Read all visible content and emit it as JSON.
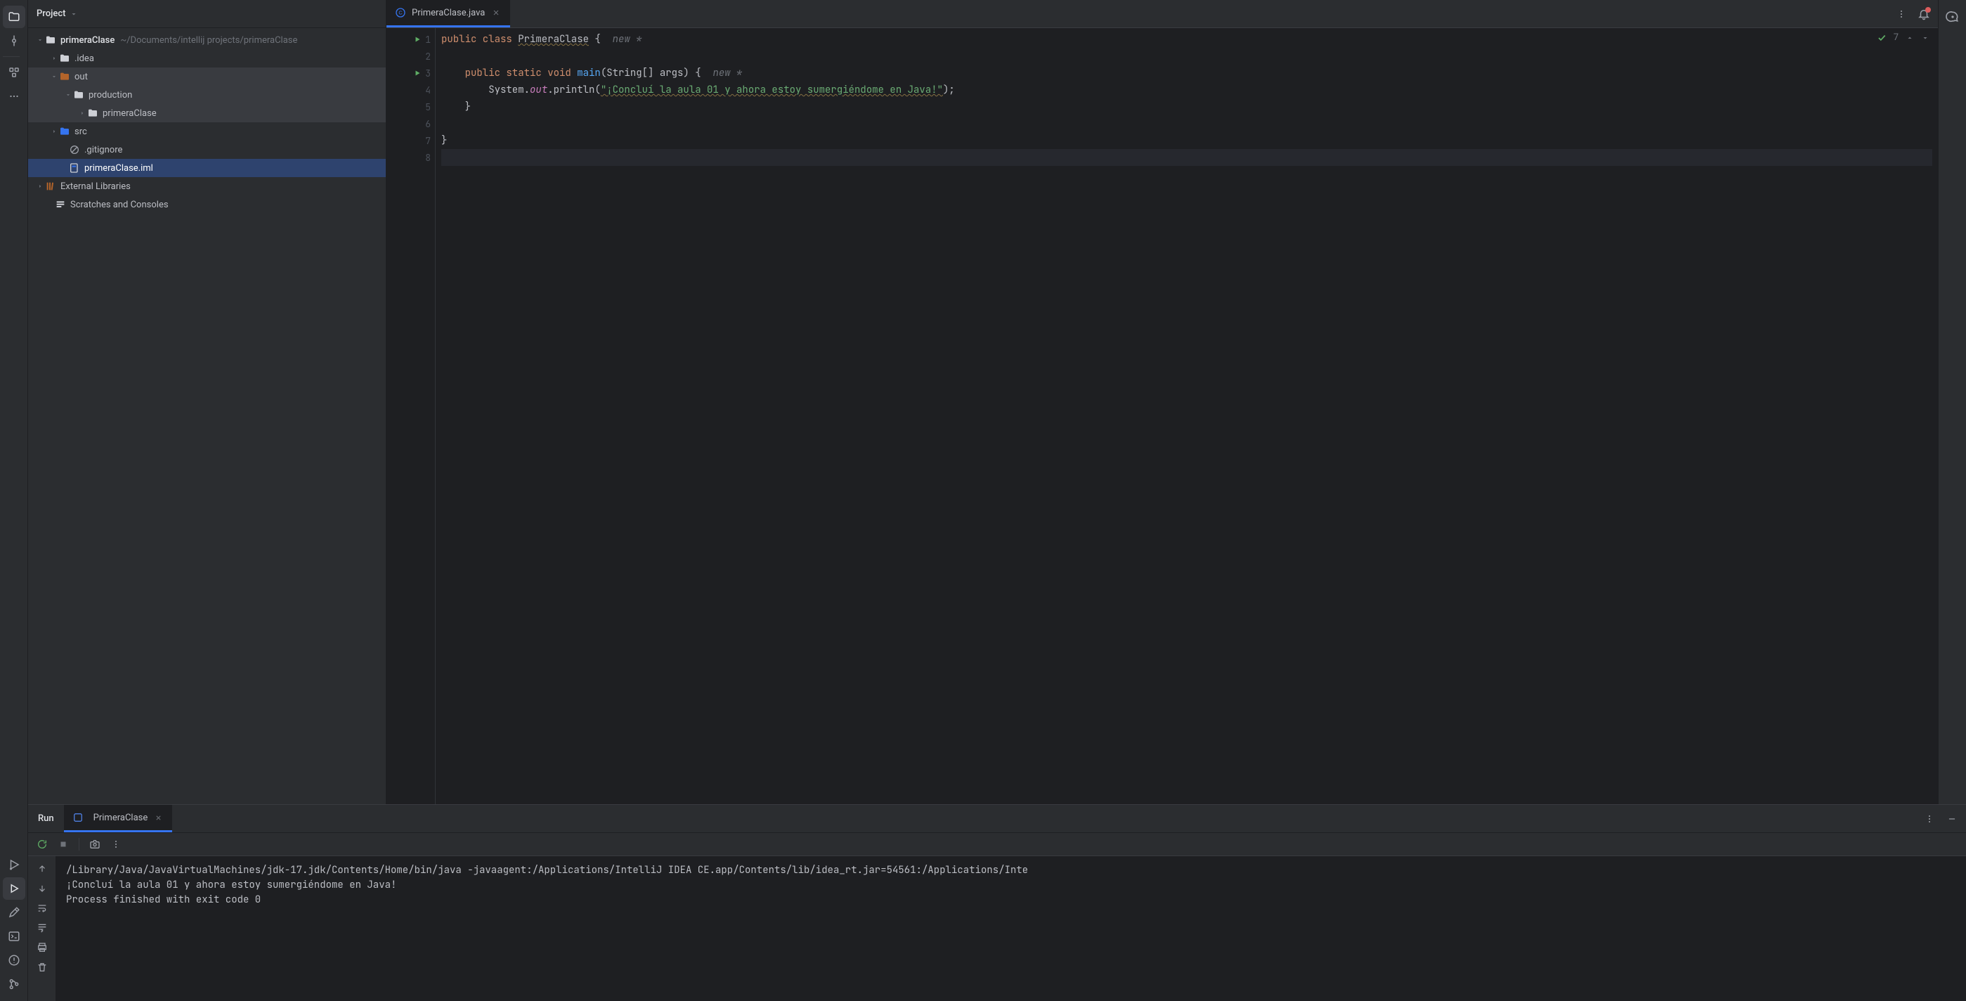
{
  "project_panel": {
    "title": "Project",
    "root": {
      "name": "primeraClase",
      "path": "~/Documents/intellij projects/primeraClase"
    },
    "nodes": {
      "idea": ".idea",
      "out": "out",
      "production": "production",
      "primeraClase_pkg": "primeraClase",
      "src": "src",
      "gitignore": ".gitignore",
      "iml": "primeraClase.iml",
      "external": "External Libraries",
      "scratches": "Scratches and Consoles"
    }
  },
  "editor": {
    "tab_name": "PrimeraClase.java",
    "inspection_count": "7",
    "code": {
      "l1": {
        "prefix": "public class ",
        "class": "PrimeraClase",
        "suffix": " {",
        "hint": "new *"
      },
      "l3": {
        "indent": "    ",
        "kw": "public static void ",
        "fn": "main",
        "args": "(String[] args) {",
        "hint": "new *"
      },
      "l4": {
        "indent": "        ",
        "sys": "System.",
        "out": "out",
        "call": ".println(",
        "str": "\"¡Concluí la aula 01 y ahora estoy sumergiéndome en Java!\"",
        "end": ");"
      },
      "l5": "    }",
      "l7": "}"
    },
    "line_numbers": [
      "1",
      "2",
      "3",
      "4",
      "5",
      "6",
      "7",
      "8"
    ]
  },
  "run": {
    "tab_label": "Run",
    "config_name": "PrimeraClase",
    "output": {
      "cmd": "/Library/Java/JavaVirtualMachines/jdk-17.jdk/Contents/Home/bin/java -javaagent:/Applications/IntelliJ IDEA CE.app/Contents/lib/idea_rt.jar=54561:/Applications/Inte",
      "line1": "¡Concluí la aula 01 y ahora estoy sumergiéndome en Java!",
      "blank": "",
      "line2": "Process finished with exit code 0"
    }
  }
}
